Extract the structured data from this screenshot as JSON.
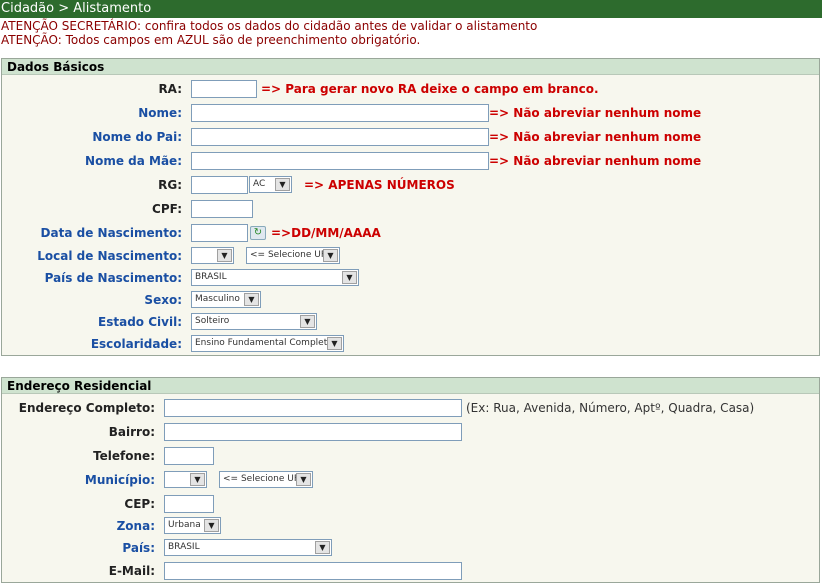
{
  "breadcrumb": "Cidadão > Alistamento",
  "warnings": [
    "ATENÇÃO SECRETÁRIO: confira todos os dados do cidadão antes de validar o alistamento",
    "ATENÇÃO: Todos campos em AZUL são de preenchimento obrigatório."
  ],
  "dados_basicos": {
    "title": "Dados Básicos",
    "ra": {
      "label": "RA:",
      "value": "",
      "hint": "=> Para gerar novo RA deixe o campo em branco."
    },
    "nome": {
      "label": "Nome:",
      "value": "",
      "hint": "=> Não abreviar nenhum nome"
    },
    "nome_pai": {
      "label": "Nome do Pai:",
      "value": "",
      "hint": "=> Não abreviar nenhum nome"
    },
    "nome_mae": {
      "label": "Nome da Mãe:",
      "value": "",
      "hint": "=> Não abreviar nenhum nome"
    },
    "rg": {
      "label": "RG:",
      "value": "",
      "uf": "AC",
      "hint": "=> APENAS NÚMEROS"
    },
    "cpf": {
      "label": "CPF:",
      "value": ""
    },
    "nascimento": {
      "label": "Data de Nascimento:",
      "value": "",
      "hint": "=>DD/MM/AAAA",
      "icon": "calendar-refresh-icon"
    },
    "local": {
      "label": "Local de Nascimento:",
      "uf": "",
      "cidade": "<= Selecione UF"
    },
    "pais": {
      "label": "País de Nascimento:",
      "value": "BRASIL"
    },
    "sexo": {
      "label": "Sexo:",
      "value": "Masculino"
    },
    "estado_civil": {
      "label": "Estado Civil:",
      "value": "Solteiro"
    },
    "escolaridade": {
      "label": "Escolaridade:",
      "value": "Ensino Fundamental Completo"
    }
  },
  "endereco": {
    "title": "Endereço Residencial",
    "completo": {
      "label": "Endereço Completo:",
      "value": "",
      "hint": "(Ex: Rua, Avenida, Número, Aptº, Quadra, Casa)"
    },
    "bairro": {
      "label": "Bairro:",
      "value": ""
    },
    "telefone": {
      "label": "Telefone:",
      "value": ""
    },
    "municipio": {
      "label": "Município:",
      "uf": "",
      "cidade": "<= Selecione UF"
    },
    "cep": {
      "label": "CEP:",
      "value": ""
    },
    "zona": {
      "label": "Zona:",
      "value": "Urbana"
    },
    "pais": {
      "label": "País:",
      "value": "BRASIL"
    },
    "email": {
      "label": "E-Mail:",
      "value": ""
    }
  },
  "colors": {
    "title_bar": "#2d6b2d",
    "panel_header": "#cfe3cf",
    "required_label": "#1a4fa3",
    "warning_text": "#8b0000",
    "hint_red": "#cc0000"
  }
}
